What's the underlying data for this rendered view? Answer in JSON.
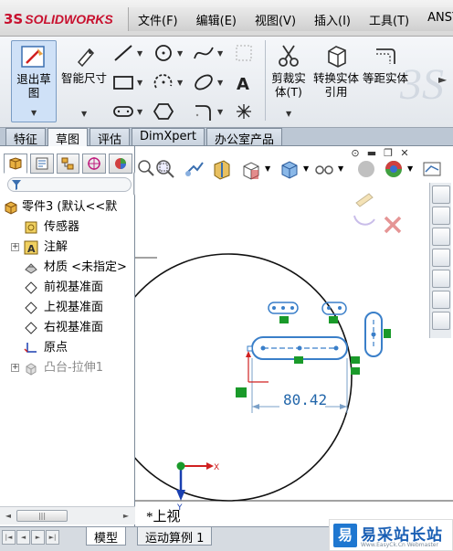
{
  "app": {
    "logo_mark": "3S",
    "logo_text": "SOLIDWORKS"
  },
  "menu": [
    "文件(F)",
    "编辑(E)",
    "视图(V)",
    "插入(I)",
    "工具(T)",
    "ANSYS"
  ],
  "ribbon": {
    "exit_sketch": "退出草图",
    "smart_dimension": "智能尺寸",
    "trim": "剪裁实体(T)",
    "convert": "转换实体引用",
    "offset": "等距实体",
    "tools": [
      "line-icon",
      "circle-icon",
      "spline-icon",
      "construction-geometry-icon",
      "rectangle-icon",
      "arc-icon",
      "ellipse-icon",
      "text-icon",
      "slot-icon",
      "polygon-icon",
      "fillet-icon",
      "point-icon"
    ]
  },
  "command_tabs": [
    "特征",
    "草图",
    "评估",
    "DimXpert",
    "办公室产品"
  ],
  "command_tabs_active": "草图",
  "tree": {
    "root": "零件3 (默认<<默",
    "items": [
      {
        "label": "传感器",
        "icon": "sensor-icon"
      },
      {
        "label": "注解",
        "icon": "annotation-icon",
        "expandable": true
      },
      {
        "label": "材质 <未指定>",
        "icon": "material-icon"
      },
      {
        "label": "前视基准面",
        "icon": "plane-icon"
      },
      {
        "label": "上视基准面",
        "icon": "plane-icon"
      },
      {
        "label": "右视基准面",
        "icon": "plane-icon"
      },
      {
        "label": "原点",
        "icon": "origin-icon"
      },
      {
        "label": "凸台-拉伸1",
        "icon": "extrude-icon",
        "expandable": true,
        "suppressed": true
      }
    ]
  },
  "sketch": {
    "dimension_value": "80.42",
    "view_name": "*上视",
    "triad_x": "X",
    "triad_y": "Y"
  },
  "bottom_tabs": [
    "模型",
    "运动算例 1"
  ],
  "bottom_tabs_active": "模型",
  "watermark": {
    "mark": "易",
    "text": "易采站长站",
    "sub": "Www.EasyCk.Cn Webmaster"
  },
  "colors": {
    "accent": "#1f77d0",
    "sketch_blue": "#3a7fc9",
    "relation_green": "#1a9a2a",
    "dimension_text": "#2266aa",
    "cancel_red": "#d04040"
  }
}
